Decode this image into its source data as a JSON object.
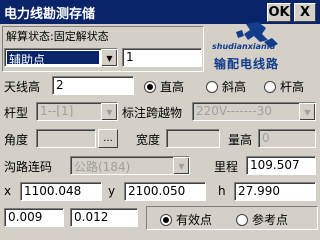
{
  "window": {
    "title": "电力线勘测存储",
    "ok_label": "OK",
    "close_label": "X"
  },
  "header": {
    "group_label": "解算状态:固定解状态",
    "point_type": "辅助点",
    "point_number": "1",
    "logo_url_text": "shudianxianlu",
    "logo_name": "输配电线路"
  },
  "antenna": {
    "label": "天线高",
    "value": "2",
    "options": [
      {
        "label": "直高",
        "selected": true
      },
      {
        "label": "斜高",
        "selected": false
      },
      {
        "label": "杆高",
        "selected": false
      }
    ]
  },
  "pole": {
    "type_label": "杆型",
    "type_value": "1--[1]",
    "crossing_label": "标注跨越物",
    "crossing_value": "220V-------30"
  },
  "angle": {
    "angle_label": "角度",
    "angle_value": "",
    "browse_label": "...",
    "width_label": "宽度",
    "width_value": "",
    "height_label": "量高",
    "height_value": "0"
  },
  "ditch": {
    "label": "沟路连码",
    "value": "公路(184)",
    "mileage_label": "里程",
    "mileage_value": "109.507"
  },
  "coords": {
    "x_label": "x",
    "x_value": "1100.048",
    "y_label": "y",
    "y_value": "2100.050",
    "h_label": "h",
    "h_value": "27.990"
  },
  "footer": {
    "value1": "0.009",
    "value2": "0.012",
    "options": [
      {
        "label": "有效点",
        "selected": true
      },
      {
        "label": "参考点",
        "selected": false
      }
    ]
  }
}
